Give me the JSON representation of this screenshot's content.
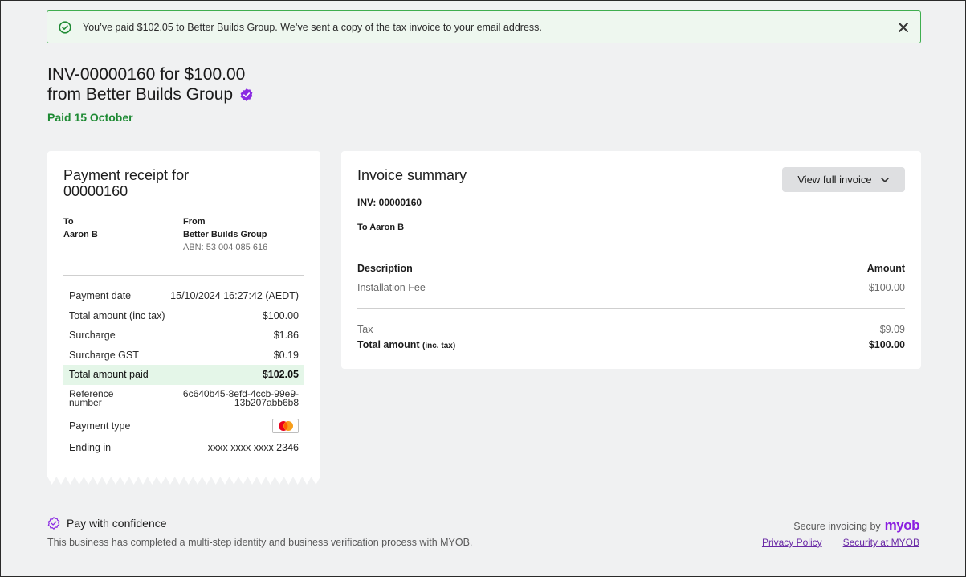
{
  "banner": {
    "message": "You’ve paid $102.05 to Better Builds Group. We’ve sent a copy of the tax invoice to your email address.",
    "icon": "check-circle-icon",
    "close_icon": "close-icon",
    "accent": "#3fae4f"
  },
  "header": {
    "title_line1": "INV-00000160 for $100.00",
    "title_line2": "from Better Builds Group",
    "verified_icon": "verified-badge-icon",
    "status": "Paid 15 October",
    "status_color": "#1e8a34"
  },
  "receipt": {
    "title": "Payment receipt for 00000160",
    "to_label": "To",
    "to_name": "Aaron B",
    "from_label": "From",
    "from_name": "Better Builds Group",
    "abn": "ABN: 53 004 085 616",
    "rows": [
      {
        "label": "Payment date",
        "value": "15/10/2024 16:27:42 (AEDT)"
      },
      {
        "label": "Total amount (inc tax)",
        "value": "$100.00"
      },
      {
        "label": "Surcharge",
        "value": "$1.86"
      },
      {
        "label": "Surcharge GST",
        "value": "$0.19"
      },
      {
        "label": "Total amount paid",
        "value": "$102.05"
      },
      {
        "label": "Reference number",
        "value": "6c640b45-8efd-4ccb-99e9-13b207abb6b8"
      },
      {
        "label": "Payment type",
        "value": "mastercard-icon"
      },
      {
        "label": "Ending in",
        "value": "xxxx xxxx xxxx 2346"
      }
    ]
  },
  "summary": {
    "title": "Invoice summary",
    "view_button": "View full invoice",
    "inv_no": "INV: 00000160",
    "to": "To Aaron B",
    "col_description": "Description",
    "col_amount": "Amount",
    "item_description": "Installation Fee",
    "item_amount": "$100.00",
    "tax_label": "Tax",
    "tax_amount": "$9.09",
    "total_label": "Total amount",
    "total_label_small": "(inc. tax)",
    "total_amount": "$100.00"
  },
  "footer": {
    "confidence_title": "Pay with confidence",
    "confidence_desc": "This business has completed a multi-step identity and business verification process with MYOB.",
    "secure_text": "Secure invoicing by",
    "brand": "myob",
    "brand_color": "#8a1ee0",
    "privacy_link": "Privacy Policy",
    "security_link": "Security at MYOB"
  }
}
